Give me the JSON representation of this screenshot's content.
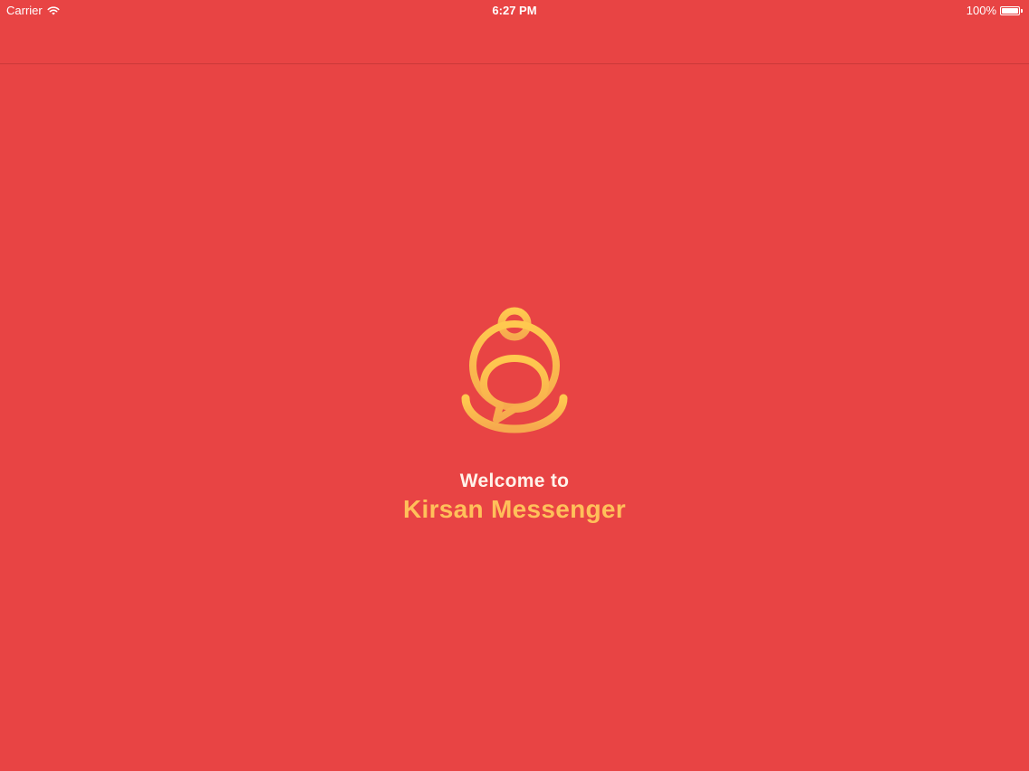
{
  "status_bar": {
    "carrier": "Carrier",
    "time": "6:27 PM",
    "battery": "100%",
    "battery_level": 1.0
  },
  "icons": {
    "wifi": "wifi-icon",
    "battery": "battery-icon",
    "logo": "kirsan-messenger-logo"
  },
  "welcome": {
    "line1": "Welcome to",
    "app_name": "Kirsan Messenger"
  },
  "colors": {
    "background": "#E84444",
    "logo_gradient_top": "#FFC94F",
    "logo_gradient_bottom": "#F6A94E",
    "app_name": "#FFC05A",
    "welcome_text": "#FFF3EA"
  }
}
